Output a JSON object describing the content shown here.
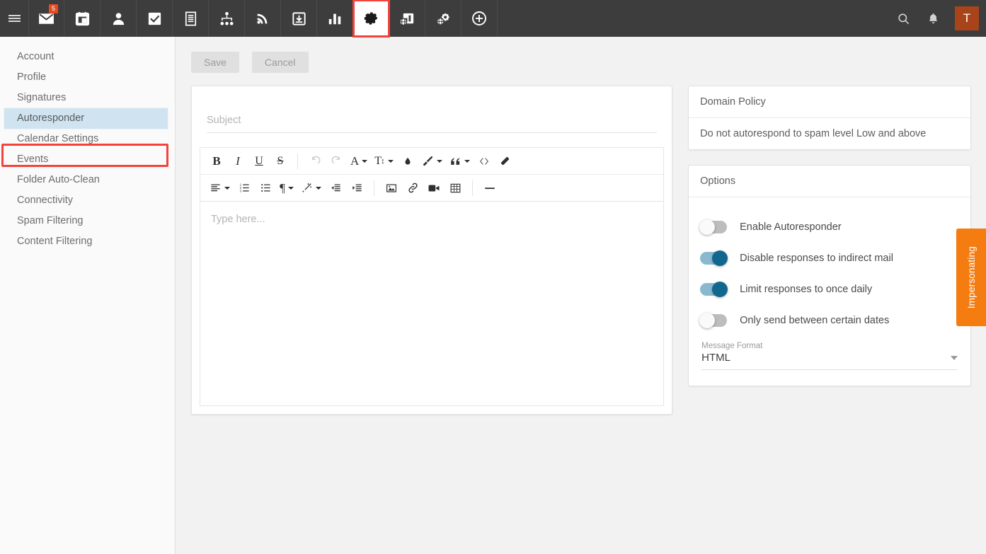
{
  "topbar": {
    "menu_icon": "hamburger-icon",
    "nav_items": [
      {
        "name": "mail",
        "icon": "envelope-icon",
        "badge": "5",
        "active": false
      },
      {
        "name": "calendar",
        "icon": "calendar-icon",
        "badge": "",
        "active": false
      },
      {
        "name": "contacts",
        "icon": "person-icon",
        "badge": "",
        "active": false
      },
      {
        "name": "tasks",
        "icon": "checkbox-icon",
        "badge": "",
        "active": false
      },
      {
        "name": "notes",
        "icon": "notes-icon",
        "badge": "",
        "active": false
      },
      {
        "name": "sitemap",
        "icon": "sitemap-icon",
        "badge": "",
        "active": false
      },
      {
        "name": "feeds",
        "icon": "rss-icon",
        "badge": "",
        "active": false
      },
      {
        "name": "filing",
        "icon": "inbox-download-icon",
        "badge": "",
        "active": false
      },
      {
        "name": "reports",
        "icon": "bar-chart-icon",
        "badge": "",
        "active": false
      },
      {
        "name": "settings",
        "icon": "gear-icon",
        "badge": "",
        "active": true
      },
      {
        "name": "domain-reports",
        "icon": "globe-chart-icon",
        "badge": "",
        "active": false
      },
      {
        "name": "domain-settings",
        "icon": "globe-gear-icon",
        "badge": "",
        "active": false
      },
      {
        "name": "add",
        "icon": "plus-circle-icon",
        "badge": "",
        "active": false
      }
    ],
    "search_icon": "search-icon",
    "bell_icon": "bell-icon",
    "avatar_initial": "T",
    "avatar_color": "#a8431a",
    "highlight_color": "#f4423c"
  },
  "sidebar": {
    "items": [
      {
        "label": "Account",
        "selected": false
      },
      {
        "label": "Profile",
        "selected": false
      },
      {
        "label": "Signatures",
        "selected": false
      },
      {
        "label": "Autoresponder",
        "selected": true
      },
      {
        "label": "Calendar Settings",
        "selected": false
      },
      {
        "label": "Events",
        "selected": false
      },
      {
        "label": "Folder Auto-Clean",
        "selected": false
      },
      {
        "label": "Connectivity",
        "selected": false
      },
      {
        "label": "Spam Filtering",
        "selected": false
      },
      {
        "label": "Content Filtering",
        "selected": false
      }
    ]
  },
  "actions": {
    "save_label": "Save",
    "cancel_label": "Cancel"
  },
  "editor": {
    "subject_value": "",
    "subject_placeholder": "Subject",
    "body_placeholder": "Type here...",
    "toolbar_row1": [
      {
        "name": "bold-button",
        "glyph": "B",
        "style": "bold",
        "caret": false,
        "dim": false
      },
      {
        "name": "italic-button",
        "glyph": "I",
        "style": "italic",
        "caret": false,
        "dim": false
      },
      {
        "name": "underline-button",
        "glyph": "U",
        "style": "underline",
        "caret": false,
        "dim": false
      },
      {
        "name": "strikethrough-button",
        "glyph": "S",
        "style": "strike",
        "caret": false,
        "dim": false
      },
      {
        "name": "separator",
        "glyph": "",
        "style": "sep",
        "caret": false,
        "dim": false
      },
      {
        "name": "undo-button",
        "glyph": "undo-icon",
        "style": "svg",
        "caret": false,
        "dim": true
      },
      {
        "name": "redo-button",
        "glyph": "redo-icon",
        "style": "svg",
        "caret": false,
        "dim": true
      },
      {
        "name": "font-color-button",
        "glyph": "A",
        "style": "plain",
        "caret": true,
        "dim": false
      },
      {
        "name": "font-size-button",
        "glyph": "text-size-icon",
        "style": "svg",
        "caret": true,
        "dim": false
      },
      {
        "name": "highlight-color-button",
        "glyph": "droplet-icon",
        "style": "svg",
        "caret": false,
        "dim": false
      },
      {
        "name": "background-color-button",
        "glyph": "paintbrush-icon",
        "style": "svg",
        "caret": true,
        "dim": false
      },
      {
        "name": "blockquote-button",
        "glyph": "quote-icon",
        "style": "svg",
        "caret": true,
        "dim": false
      },
      {
        "name": "source-code-button",
        "glyph": "code-icon",
        "style": "svg",
        "caret": false,
        "dim": false
      },
      {
        "name": "clear-formatting-button",
        "glyph": "eraser-icon",
        "style": "svg",
        "caret": false,
        "dim": false
      }
    ],
    "toolbar_row2": [
      {
        "name": "align-button",
        "glyph": "align-left-icon",
        "style": "svg",
        "caret": true,
        "dim": false
      },
      {
        "name": "ordered-list-button",
        "glyph": "ordered-list-icon",
        "style": "svg",
        "caret": false,
        "dim": false
      },
      {
        "name": "unordered-list-button",
        "glyph": "unordered-list-icon",
        "style": "svg",
        "caret": false,
        "dim": false
      },
      {
        "name": "paragraph-format-button",
        "glyph": "pilcrow-icon",
        "style": "plain",
        "caret": true,
        "dim": false
      },
      {
        "name": "paragraph-style-button",
        "glyph": "magic-wand-icon",
        "style": "svg",
        "caret": true,
        "dim": false
      },
      {
        "name": "outdent-button",
        "glyph": "outdent-icon",
        "style": "svg",
        "caret": false,
        "dim": false
      },
      {
        "name": "indent-button",
        "glyph": "indent-icon",
        "style": "svg",
        "caret": false,
        "dim": false
      },
      {
        "name": "separator",
        "glyph": "",
        "style": "sep",
        "caret": false,
        "dim": false
      },
      {
        "name": "insert-image-button",
        "glyph": "image-icon",
        "style": "svg",
        "caret": false,
        "dim": false
      },
      {
        "name": "insert-link-button",
        "glyph": "link-icon",
        "style": "svg",
        "caret": false,
        "dim": false
      },
      {
        "name": "insert-video-button",
        "glyph": "video-icon",
        "style": "svg",
        "caret": false,
        "dim": false
      },
      {
        "name": "insert-table-button",
        "glyph": "table-icon",
        "style": "svg",
        "caret": false,
        "dim": false
      },
      {
        "name": "separator",
        "glyph": "",
        "style": "sep",
        "caret": false,
        "dim": false
      },
      {
        "name": "horizontal-rule-button",
        "glyph": "horizontal-rule-icon",
        "style": "svg",
        "caret": false,
        "dim": false
      }
    ]
  },
  "domain_policy": {
    "title": "Domain Policy",
    "text": "Do not autorespond to spam level Low and above"
  },
  "options": {
    "title": "Options",
    "toggles": [
      {
        "label": "Enable Autoresponder",
        "on": false
      },
      {
        "label": "Disable responses to indirect mail",
        "on": true
      },
      {
        "label": "Limit responses to once daily",
        "on": true
      },
      {
        "label": "Only send between certain dates",
        "on": false
      }
    ],
    "message_format_label": "Message Format",
    "message_format_value": "HTML",
    "toggle_on_color": "#12678f",
    "toggle_track_on_color": "#89b9d1"
  },
  "impersonating": {
    "label": "Impersonating",
    "color": "#f57c10"
  }
}
